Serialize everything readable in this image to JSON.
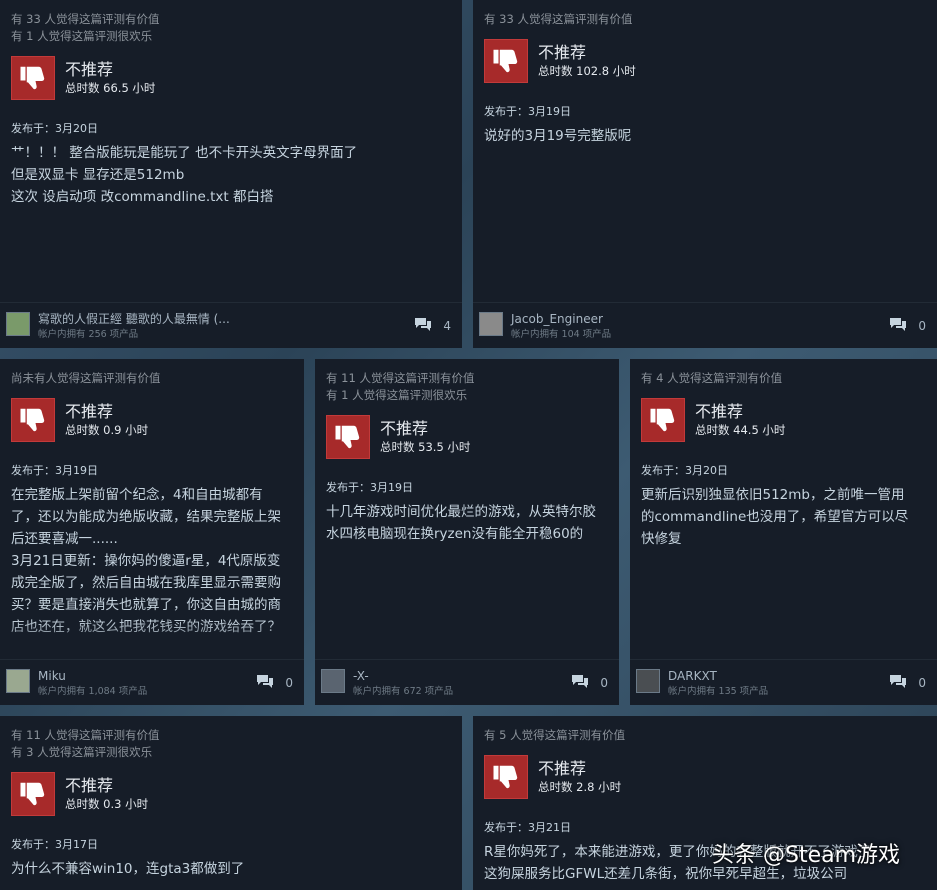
{
  "reviews": [
    {
      "helpful": [
        "有 33 人觉得这篇评测有价值",
        "有 1 人觉得这篇评测很欢乐"
      ],
      "recommendation": "不推荐",
      "hours": "总时数 66.5 小时",
      "posted": "发布于：3月20日",
      "content": [
        "艹！！！ 整合版能玩是能玩了 也不卡开头英文字母界面了",
        "但是双显卡 显存还是512mb",
        "这次 设启动项 改commandline.txt 都白搭"
      ],
      "username": "寫歌的人假正經 聽歌的人最無情 (...",
      "owned": "帐户内拥有 256 项产品",
      "comments": "4",
      "avatar_color": "#7a9a6a"
    },
    {
      "helpful": [
        "有 33 人觉得这篇评测有价值"
      ],
      "recommendation": "不推荐",
      "hours": "总时数 102.8 小时",
      "posted": "发布于：3月19日",
      "content": [
        "说好的3月19号完整版呢"
      ],
      "username": "Jacob_Engineer",
      "owned": "帐户内拥有 104 项产品",
      "comments": "0",
      "avatar_color": "#8a8a8a"
    },
    {
      "helpful": [
        "尚未有人觉得这篇评测有价值"
      ],
      "recommendation": "不推荐",
      "hours": "总时数 0.9 小时",
      "posted": "发布于：3月19日",
      "content": [
        "在完整版上架前留个纪念，4和自由城都有",
        "了，还以为能成为绝版收藏，结果完整版上架",
        "后还要喜减一......",
        "3月21日更新：操你妈的傻逼r星，4代原版变",
        "成完全版了，然后自由城在我库里显示需要购",
        "买？要是直接消失也就算了，你这自由城的商",
        "店也还在，就这么把我花钱买的游戏给吞了？"
      ],
      "username": "Miku",
      "owned": "帐户内拥有 1,084 项产品",
      "comments": "0",
      "avatar_color": "#9aa890"
    },
    {
      "helpful": [
        "有 11 人觉得这篇评测有价值",
        "有 1 人觉得这篇评测很欢乐"
      ],
      "recommendation": "不推荐",
      "hours": "总时数 53.5 小时",
      "posted": "发布于：3月19日",
      "content": [
        "十几年游戏时间优化最烂的游戏，从英特尔胶",
        "水四核电脑现在换ryzen没有能全开稳60的"
      ],
      "username": "-X-",
      "owned": "帐户内拥有 672 项产品",
      "comments": "0",
      "avatar_color": "#5a6470"
    },
    {
      "helpful": [
        "有 4 人觉得这篇评测有价值"
      ],
      "recommendation": "不推荐",
      "hours": "总时数 44.5 小时",
      "posted": "发布于：3月20日",
      "content": [
        "更新后识别独显依旧512mb，之前唯一管用",
        "的commandline也没用了，希望官方可以尽",
        "快修复"
      ],
      "username": "DARKXT",
      "owned": "帐户内拥有 135 项产品",
      "comments": "0",
      "avatar_color": "#4a4e52"
    },
    {
      "helpful": [
        "有 11 人觉得这篇评测有价值",
        "有 3 人觉得这篇评测很欢乐"
      ],
      "recommendation": "不推荐",
      "hours": "总时数 0.3 小时",
      "posted": "发布于：3月17日",
      "content": [
        "为什么不兼容win10，连gta3都做到了"
      ],
      "username": "",
      "owned": "",
      "comments": "",
      "avatar_color": ""
    },
    {
      "helpful": [
        "有 5 人觉得这篇评测有价值"
      ],
      "recommendation": "不推荐",
      "hours": "总时数 2.8 小时",
      "posted": "发布于：3月21日",
      "content": [
        "R星你妈死了，本来能进游戏，更了你妈的完整版就开不了游戏了",
        "这狗屎服务比GFWL还差几条街，祝你早死早超生，垃圾公司"
      ],
      "username": "",
      "owned": "",
      "comments": "",
      "avatar_color": ""
    }
  ],
  "watermark": "头条 @Steam游戏",
  "colors": {
    "thumb_bg": "#a72a2a",
    "card_bg": "#161d28",
    "text": "#c6d4df"
  }
}
